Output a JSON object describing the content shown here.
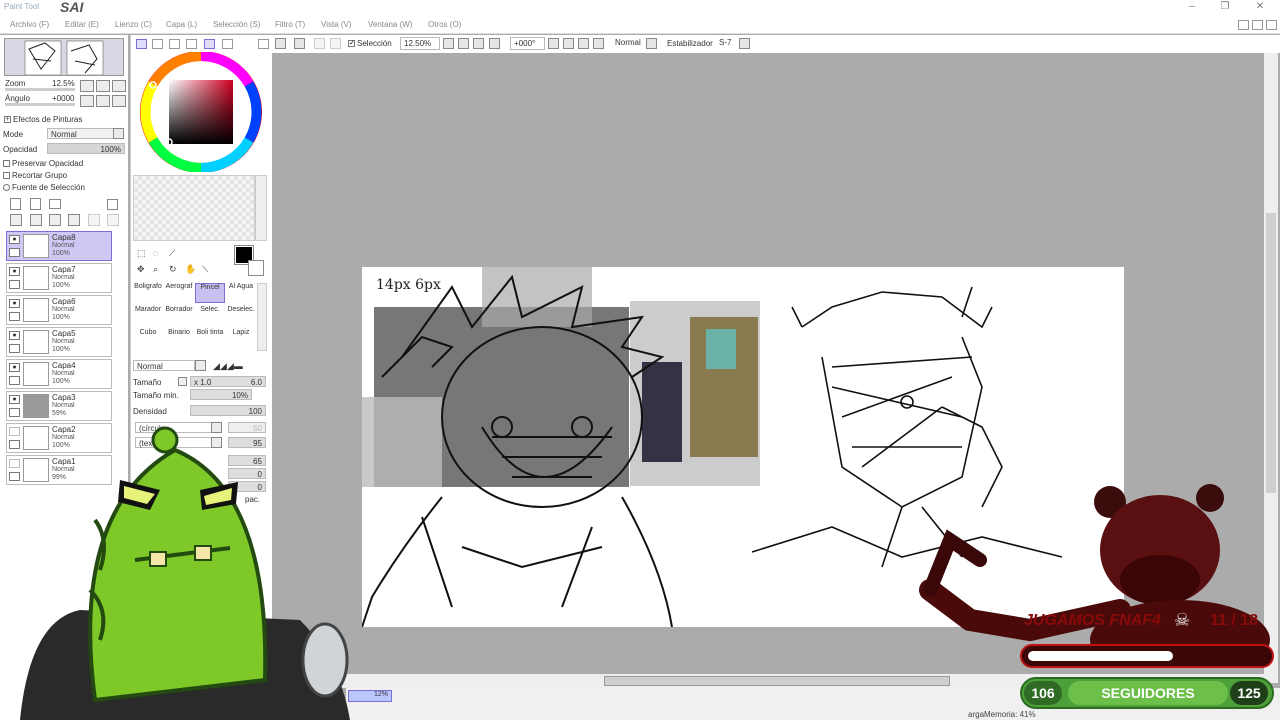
{
  "app": {
    "logo_text": "Paint Tool",
    "name": "SAI",
    "window_buttons": [
      "–",
      "❐",
      "✕"
    ]
  },
  "menu": [
    {
      "label": "Archivo (F)"
    },
    {
      "label": "Editar (E)"
    },
    {
      "label": "Lienzo (C)"
    },
    {
      "label": "Capa (L)"
    },
    {
      "label": "Selección (S)"
    },
    {
      "label": "Filtro (T)"
    },
    {
      "label": "Vista (V)"
    },
    {
      "label": "Ventana (W)"
    },
    {
      "label": "Otros (O)"
    }
  ],
  "toolbar": {
    "selection_label": "Selección",
    "zoom_value": "12.50%",
    "angle_value": "+000°",
    "blend_mode": "Normal",
    "stabilizer_label": "Estabilizador",
    "stabilizer_value": "S-7"
  },
  "navigator": {
    "zoom_label": "Zoom",
    "zoom_value": "12.5%",
    "angle_label": "Ángulo",
    "angle_value": "+0000"
  },
  "layer_panel": {
    "effects_label": "Efectos de Pinturas",
    "mode_label": "Mode",
    "mode_value": "Normal",
    "opacity_label": "Opacidad",
    "opacity_value": "100%",
    "preserve_opacity": "Preservar Opacidad",
    "clip_group": "Recortar Grupo",
    "selection_source": "Fuente de Selección",
    "layers": [
      {
        "name": "Capa8",
        "mode": "Normal",
        "opacity": "100%",
        "selected": true
      },
      {
        "name": "Capa7",
        "mode": "Normal",
        "opacity": "100%",
        "selected": false
      },
      {
        "name": "Capa6",
        "mode": "Normal",
        "opacity": "100%",
        "selected": false
      },
      {
        "name": "Capa5",
        "mode": "Normal",
        "opacity": "100%",
        "selected": false
      },
      {
        "name": "Capa4",
        "mode": "Normal",
        "opacity": "100%",
        "selected": false
      },
      {
        "name": "Capa3",
        "mode": "Normal",
        "opacity": "59%",
        "selected": false
      },
      {
        "name": "Capa2",
        "mode": "Normal",
        "opacity": "100%",
        "selected": false
      },
      {
        "name": "Capa1",
        "mode": "Normal",
        "opacity": "99%",
        "selected": false
      }
    ]
  },
  "tools": {
    "brushes": [
      [
        "Boligrafo",
        "Aerograf",
        "Pincel",
        "Al Agua"
      ],
      [
        "Marador",
        "Borrador",
        "Selec.",
        "Deselec."
      ],
      [
        "Cubo",
        "Binario",
        "Boli tinta",
        "Lapiz"
      ]
    ],
    "selected_brush": "Pincel",
    "blend_mode": "Normal",
    "size_label": "Tamaño",
    "size_multiplier": "x 1.0",
    "size_value": "6.0",
    "min_size_label": "Tamaño min.",
    "min_size_value": "10%",
    "density_label": "Densidad",
    "density_value": "100",
    "shape_value": "(círculo",
    "texture_value": "(text",
    "slider_values": [
      "50",
      "95",
      "65",
      "0",
      "0"
    ],
    "other_label": "pac."
  },
  "canvas_annotation": "14px 6px",
  "status": {
    "brush_size_readout": "12%",
    "memory_text": "argaMemoria: 41%"
  },
  "stream_overlay": {
    "goal_text": "JUGAMOS FNAF4",
    "goal_icon": "skull-icon",
    "goal_count": "11 / 18",
    "goal_progress": 0.61,
    "followers_current": "106",
    "followers_label": "SEGUIDORES",
    "followers_target": "125"
  },
  "colors": {
    "selected_layer": "#cfc8f4",
    "accent": "#7b6fd6",
    "follower_green": "#6cc04a",
    "goal_red": "#c01010"
  }
}
